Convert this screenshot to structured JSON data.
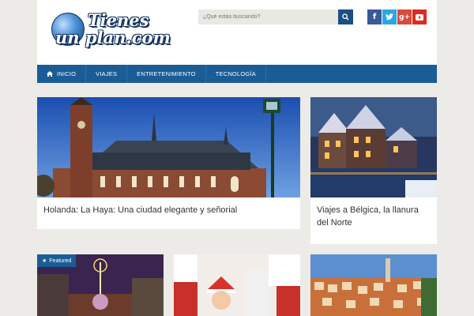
{
  "header": {
    "logo_line1": "Tienes",
    "logo_line2": "un plan.com"
  },
  "search": {
    "placeholder": "¿Qué estás buscando?",
    "button_icon": "search-icon"
  },
  "social": [
    {
      "name": "facebook",
      "glyph": "f",
      "color": "#3b5998"
    },
    {
      "name": "twitter",
      "glyph": "t",
      "color": "#2ba8e0"
    },
    {
      "name": "google-plus",
      "glyph": "g+",
      "color": "#d84b3c"
    },
    {
      "name": "youtube",
      "glyph": "▶",
      "color": "#e02a20"
    }
  ],
  "nav": {
    "items": [
      "INICIO",
      "VIAJES",
      "ENTRETENIMIENTO",
      "TECNOLOGÍA"
    ]
  },
  "posts": {
    "main_title": "Holanda: La Haya: Una ciudad elegante y señorial",
    "side_title": "Viajes a Bélgica, la llanura del Norte",
    "featured_badge": "Featured"
  },
  "colors": {
    "brand_blue": "#1a5c96",
    "background": "#ecebe8"
  }
}
